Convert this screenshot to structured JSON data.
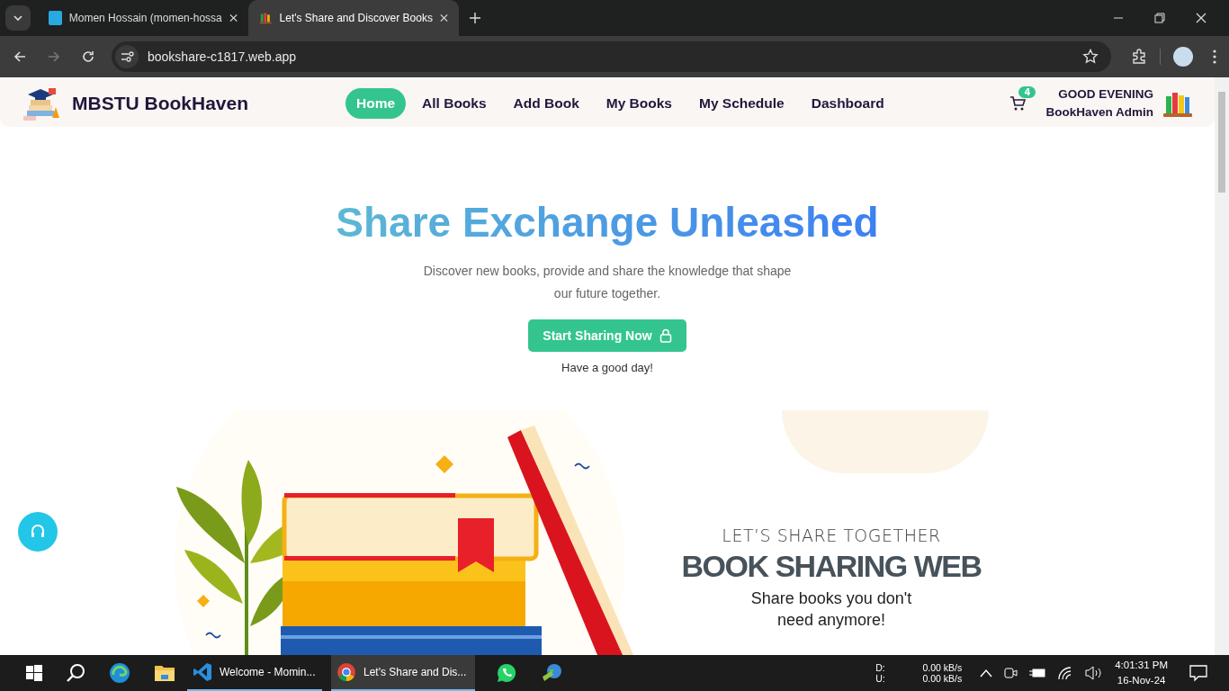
{
  "browser": {
    "tabs": [
      {
        "title": "Momen Hossain (momen-hossa",
        "kind": "ibb",
        "selected": false
      },
      {
        "title": "Let's Share and Discover Books",
        "kind": "books",
        "selected": true
      }
    ],
    "url": "bookshare-c1817.web.app"
  },
  "site": {
    "brand": "MBSTU BookHaven",
    "nav": [
      {
        "label": "Home",
        "selected": true
      },
      {
        "label": "All Books",
        "selected": false
      },
      {
        "label": "Add Book",
        "selected": false
      },
      {
        "label": "My Books",
        "selected": false
      },
      {
        "label": "My Schedule",
        "selected": false
      },
      {
        "label": "Dashboard",
        "selected": false
      }
    ],
    "cart_count": "4",
    "greeting": "GOOD EVENING",
    "user": "BookHaven Admin"
  },
  "hero": {
    "title": "Share Exchange Unleashed",
    "subtitle": "Discover new books, provide and share the knowledge that shape our future together.",
    "cta": "Start Sharing Now",
    "note": "Have a good day!"
  },
  "banner": {
    "kicker": "LET’S SHARE TOGETHER",
    "headline": "BOOK SHARING WEB",
    "tagline": "Share books you don't need anymore!"
  },
  "taskbar": {
    "apps": [
      {
        "label": "Welcome - Momin...",
        "kind": "vscode",
        "selected": false
      },
      {
        "label": "Let's Share and Dis...",
        "kind": "chrome",
        "selected": true
      }
    ],
    "net": [
      {
        "label": "D:",
        "value": "0.00 kB/s"
      },
      {
        "label": "U:",
        "value": "0.00 kB/s"
      }
    ],
    "time": "4:01:31 PM",
    "date": "16-Nov-24"
  }
}
